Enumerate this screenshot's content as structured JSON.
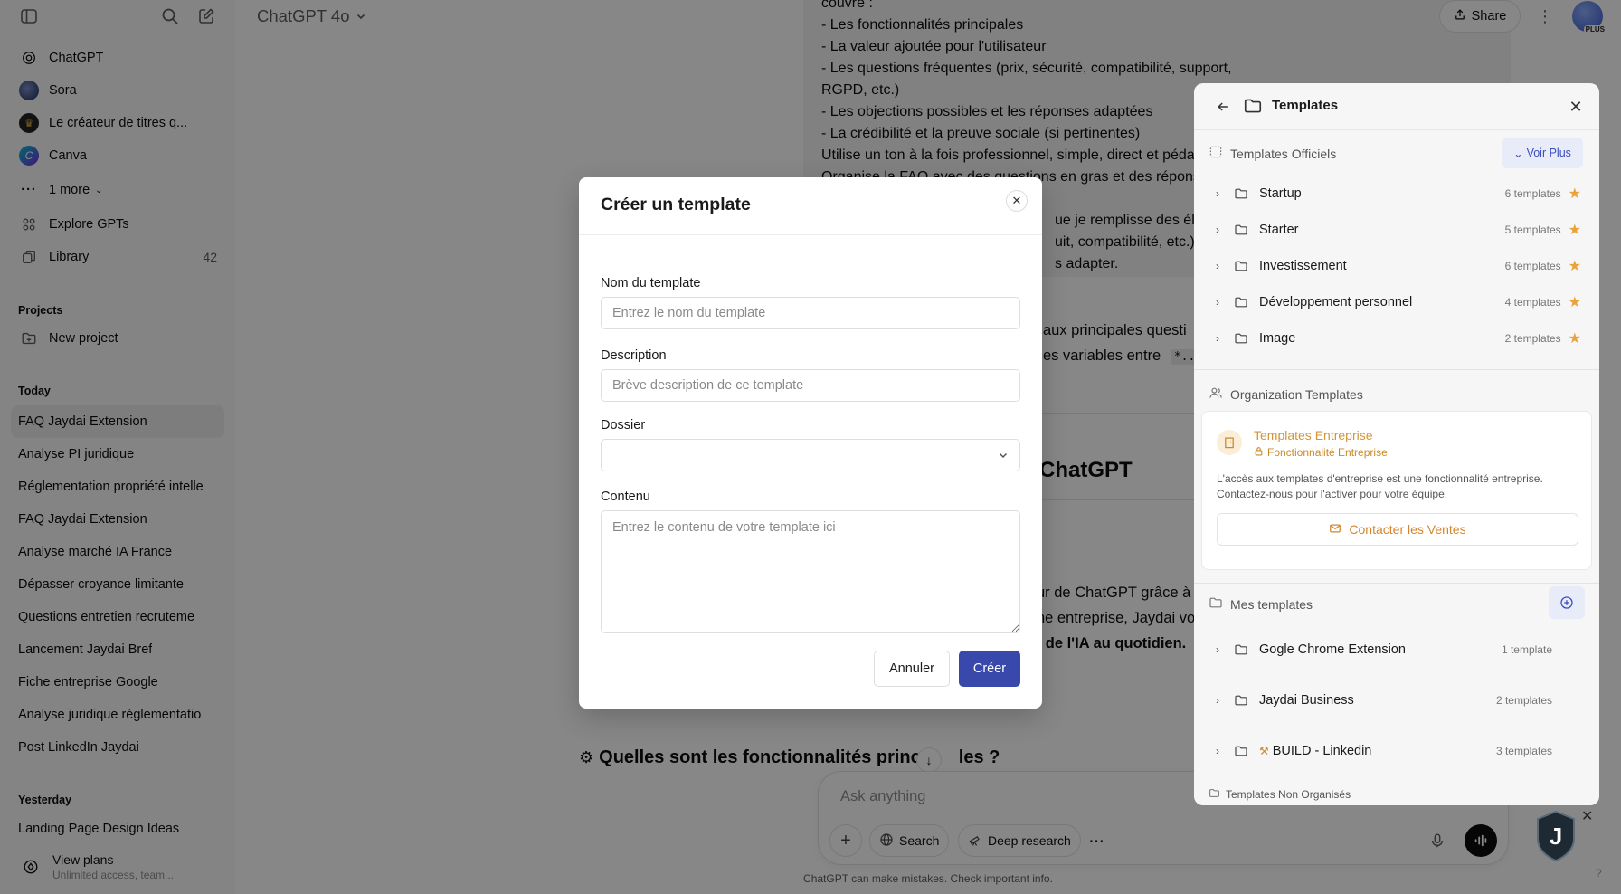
{
  "sidebar": {
    "items_top": [
      {
        "label": "ChatGPT"
      },
      {
        "label": "Sora"
      },
      {
        "label": "Le créateur de titres q..."
      },
      {
        "label": "Canva"
      },
      {
        "label": "1 more"
      },
      {
        "label": "Explore GPTs"
      },
      {
        "label": "Library",
        "badge": "42"
      }
    ],
    "projects_heading": "Projects",
    "new_project": "New project",
    "today_heading": "Today",
    "today_chats": [
      "FAQ Jaydai Extension",
      "Analyse PI juridique",
      "Réglementation propriété intelle",
      "FAQ Jaydai Extension",
      "Analyse marché IA France",
      "Dépasser croyance limitante",
      "Questions entretien recruteme",
      "Lancement Jaydai Bref",
      "Fiche entreprise Google",
      "Analyse juridique réglementatio",
      "Post LinkedIn Jaydai"
    ],
    "yesterday_heading": "Yesterday",
    "yesterday_partial": "Landing Page Design Ideas",
    "view_plans": "View plans",
    "view_plans_sub": "Unlimited access, team..."
  },
  "header": {
    "model": "ChatGPT 4o",
    "share": "Share",
    "plus_badge": "PLUS"
  },
  "conversation": {
    "user_lines": [
      "couvre :",
      "- Les fonctionnalités principales",
      "- La valeur ajoutée pour l'utilisateur",
      "- Les questions fréquentes (prix, sécurité, compatibilité, support,",
      "RGPD, etc.)",
      "- Les objections possibles et les réponses adaptées",
      "- La crédibilité et la preuve sociale (si pertinentes)",
      "Utilise un ton à la fois professionnel, simple, direct et pédag",
      "Organise la FAQ avec des questions en gras et des réponse",
      "",
      "ue je remplisse des élém",
      "uit, compatibilité, etc.),",
      "s adapter."
    ],
    "assist_line1": "aux principales questi",
    "assist_line2": "es variables entre",
    "assist_code": "*...*",
    "assist_heading": "ChatGPT",
    "assist_line3": "ur de ChatGPT grâce à",
    "assist_line4": "ne entreprise, Jaydai vo",
    "assist_line5": "e de l'IA au quotidien.",
    "section_heading": "Quelles sont les fonctionnalités princ",
    "section_heading_end": "les ?"
  },
  "composer": {
    "placeholder": "Ask anything",
    "search": "Search",
    "deep_research": "Deep research",
    "disclaimer": "ChatGPT can make mistakes. Check important info."
  },
  "templates_panel": {
    "title": "Templates",
    "official_heading": "Templates Officiels",
    "voir_plus": "Voir Plus",
    "official_folders": [
      {
        "name": "Startup",
        "count": "6 templates"
      },
      {
        "name": "Starter",
        "count": "5 templates"
      },
      {
        "name": "Investissement",
        "count": "6 templates"
      },
      {
        "name": "Développement personnel",
        "count": "4 templates"
      },
      {
        "name": "Image",
        "count": "2 templates"
      }
    ],
    "org_heading": "Organization Templates",
    "org_card_title": "Templates Entreprise",
    "org_card_sub": "Fonctionnalité Entreprise",
    "org_card_desc": "L'accès aux templates d'entreprise est une fonctionnalité entreprise. Contactez-nous pour l'activer pour votre équipe.",
    "contact_sales": "Contacter les Ventes",
    "mine_heading": "Mes templates",
    "my_folders": [
      {
        "name": "Gogle Chrome Extension",
        "count": "1 template"
      },
      {
        "name": "Jaydai Business",
        "count": "2 templates"
      },
      {
        "name": "BUILD - Linkedin",
        "count": "3 templates"
      }
    ],
    "unorganized": "Templates Non Organisés"
  },
  "modal": {
    "title": "Créer un template",
    "name_label": "Nom du template",
    "name_placeholder": "Entrez le nom du template",
    "desc_label": "Description",
    "desc_placeholder": "Brève description de ce template",
    "folder_label": "Dossier",
    "content_label": "Contenu",
    "content_placeholder": "Entrez le contenu de votre template ici",
    "cancel": "Annuler",
    "create": "Créer"
  },
  "colors": {
    "primary_button": "#3949ab",
    "star": "#e8a33c",
    "enterprise_orange": "#d69534",
    "overlay": "rgba(0,0,0,0.47)"
  }
}
